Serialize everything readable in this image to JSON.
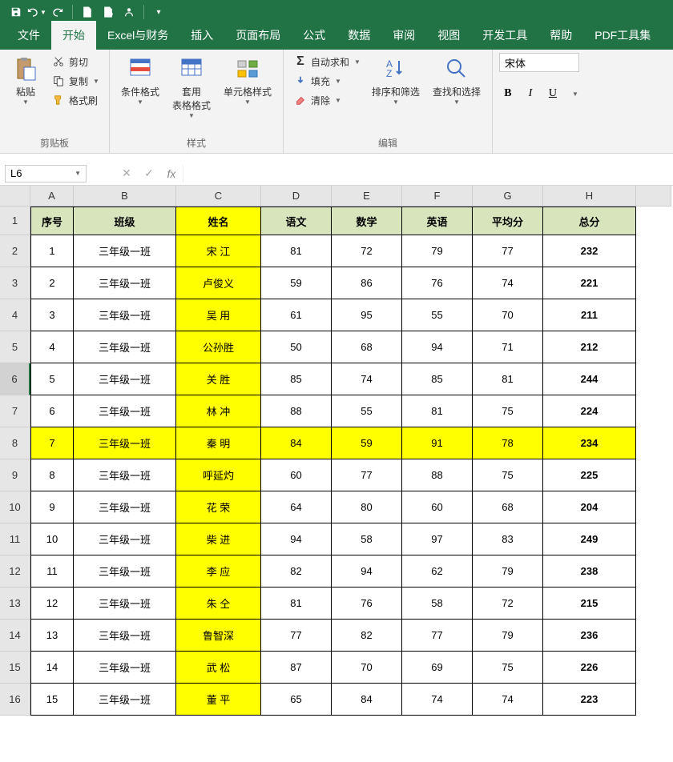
{
  "qat": {
    "save": "save-icon",
    "undo": "undo-icon",
    "redo": "redo-icon"
  },
  "tabs": [
    "文件",
    "开始",
    "Excel与财务",
    "插入",
    "页面布局",
    "公式",
    "数据",
    "审阅",
    "视图",
    "开发工具",
    "帮助",
    "PDF工具集"
  ],
  "active_tab": 1,
  "ribbon": {
    "clipboard": {
      "label": "剪贴板",
      "paste": "粘贴",
      "cut": "剪切",
      "copy": "复制",
      "format_painter": "格式刷"
    },
    "styles": {
      "label": "样式",
      "cond_fmt": "条件格式",
      "table_fmt": "套用\n表格格式",
      "cell_style": "单元格样式"
    },
    "editing": {
      "label": "编辑",
      "autosum": "自动求和",
      "fill": "填充",
      "clear": "清除",
      "sort_filter": "排序和筛选",
      "find_select": "查找和选择"
    },
    "font": {
      "name": "宋体",
      "bold": "B",
      "italic": "I",
      "underline": "U"
    }
  },
  "name_box": "L6",
  "columns": [
    "A",
    "B",
    "C",
    "D",
    "E",
    "F",
    "G",
    "H"
  ],
  "headers": [
    "序号",
    "班级",
    "姓名",
    "语文",
    "数学",
    "英语",
    "平均分",
    "总分"
  ],
  "rows": [
    {
      "n": "1",
      "cls": "三年级一班",
      "name": "宋   江",
      "c": "81",
      "m": "72",
      "e": "79",
      "avg": "77",
      "tot": "232",
      "hl": false
    },
    {
      "n": "2",
      "cls": "三年级一班",
      "name": "卢俊义",
      "c": "59",
      "m": "86",
      "e": "76",
      "avg": "74",
      "tot": "221",
      "hl": false
    },
    {
      "n": "3",
      "cls": "三年级一班",
      "name": "吴   用",
      "c": "61",
      "m": "95",
      "e": "55",
      "avg": "70",
      "tot": "211",
      "hl": false
    },
    {
      "n": "4",
      "cls": "三年级一班",
      "name": "公孙胜",
      "c": "50",
      "m": "68",
      "e": "94",
      "avg": "71",
      "tot": "212",
      "hl": false
    },
    {
      "n": "5",
      "cls": "三年级一班",
      "name": "关   胜",
      "c": "85",
      "m": "74",
      "e": "85",
      "avg": "81",
      "tot": "244",
      "hl": false
    },
    {
      "n": "6",
      "cls": "三年级一班",
      "name": "林   冲",
      "c": "88",
      "m": "55",
      "e": "81",
      "avg": "75",
      "tot": "224",
      "hl": false
    },
    {
      "n": "7",
      "cls": "三年级一班",
      "name": "秦   明",
      "c": "84",
      "m": "59",
      "e": "91",
      "avg": "78",
      "tot": "234",
      "hl": true
    },
    {
      "n": "8",
      "cls": "三年级一班",
      "name": "呼延灼",
      "c": "60",
      "m": "77",
      "e": "88",
      "avg": "75",
      "tot": "225",
      "hl": false
    },
    {
      "n": "9",
      "cls": "三年级一班",
      "name": "花   荣",
      "c": "64",
      "m": "80",
      "e": "60",
      "avg": "68",
      "tot": "204",
      "hl": false
    },
    {
      "n": "10",
      "cls": "三年级一班",
      "name": "柴   进",
      "c": "94",
      "m": "58",
      "e": "97",
      "avg": "83",
      "tot": "249",
      "hl": false
    },
    {
      "n": "11",
      "cls": "三年级一班",
      "name": "李   应",
      "c": "82",
      "m": "94",
      "e": "62",
      "avg": "79",
      "tot": "238",
      "hl": false
    },
    {
      "n": "12",
      "cls": "三年级一班",
      "name": "朱   仝",
      "c": "81",
      "m": "76",
      "e": "58",
      "avg": "72",
      "tot": "215",
      "hl": false
    },
    {
      "n": "13",
      "cls": "三年级一班",
      "name": "鲁智深",
      "c": "77",
      "m": "82",
      "e": "77",
      "avg": "79",
      "tot": "236",
      "hl": false
    },
    {
      "n": "14",
      "cls": "三年级一班",
      "name": "武   松",
      "c": "87",
      "m": "70",
      "e": "69",
      "avg": "75",
      "tot": "226",
      "hl": false
    },
    {
      "n": "15",
      "cls": "三年级一班",
      "name": "董   平",
      "c": "65",
      "m": "84",
      "e": "74",
      "avg": "74",
      "tot": "223",
      "hl": false
    }
  ],
  "selected_row_idx": 4
}
